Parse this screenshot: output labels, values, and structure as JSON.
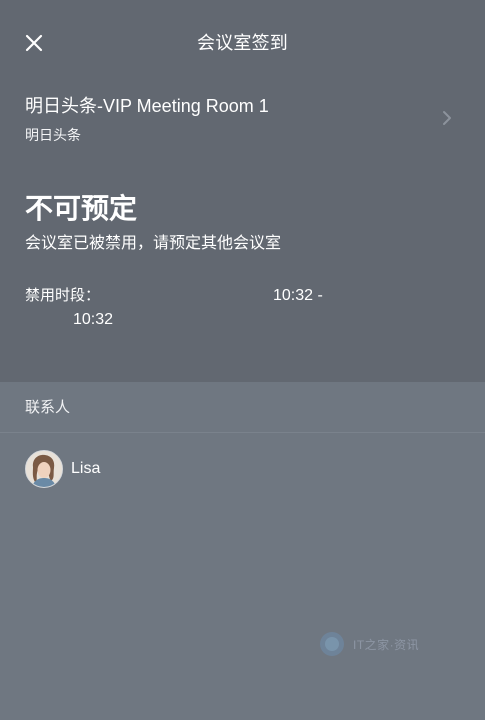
{
  "header": {
    "title": "会议室签到",
    "close_icon": "close-icon"
  },
  "room": {
    "name": "明日头条-VIP Meeting Room 1",
    "org": "明日头条"
  },
  "status": {
    "title": "不可预定",
    "description": "会议室已被禁用，请预定其他会议室"
  },
  "disabled_period": {
    "label": "禁用时段：",
    "time_line1": "10:32 -",
    "time_line2": "10:32"
  },
  "contacts": {
    "heading": "联系人",
    "items": [
      {
        "name": "Lisa"
      }
    ]
  },
  "watermark": {
    "text": "IT之家·资讯"
  },
  "colors": {
    "top_panel": "#626871",
    "bottom_panel": "#6f7781",
    "text": "#ffffff"
  }
}
